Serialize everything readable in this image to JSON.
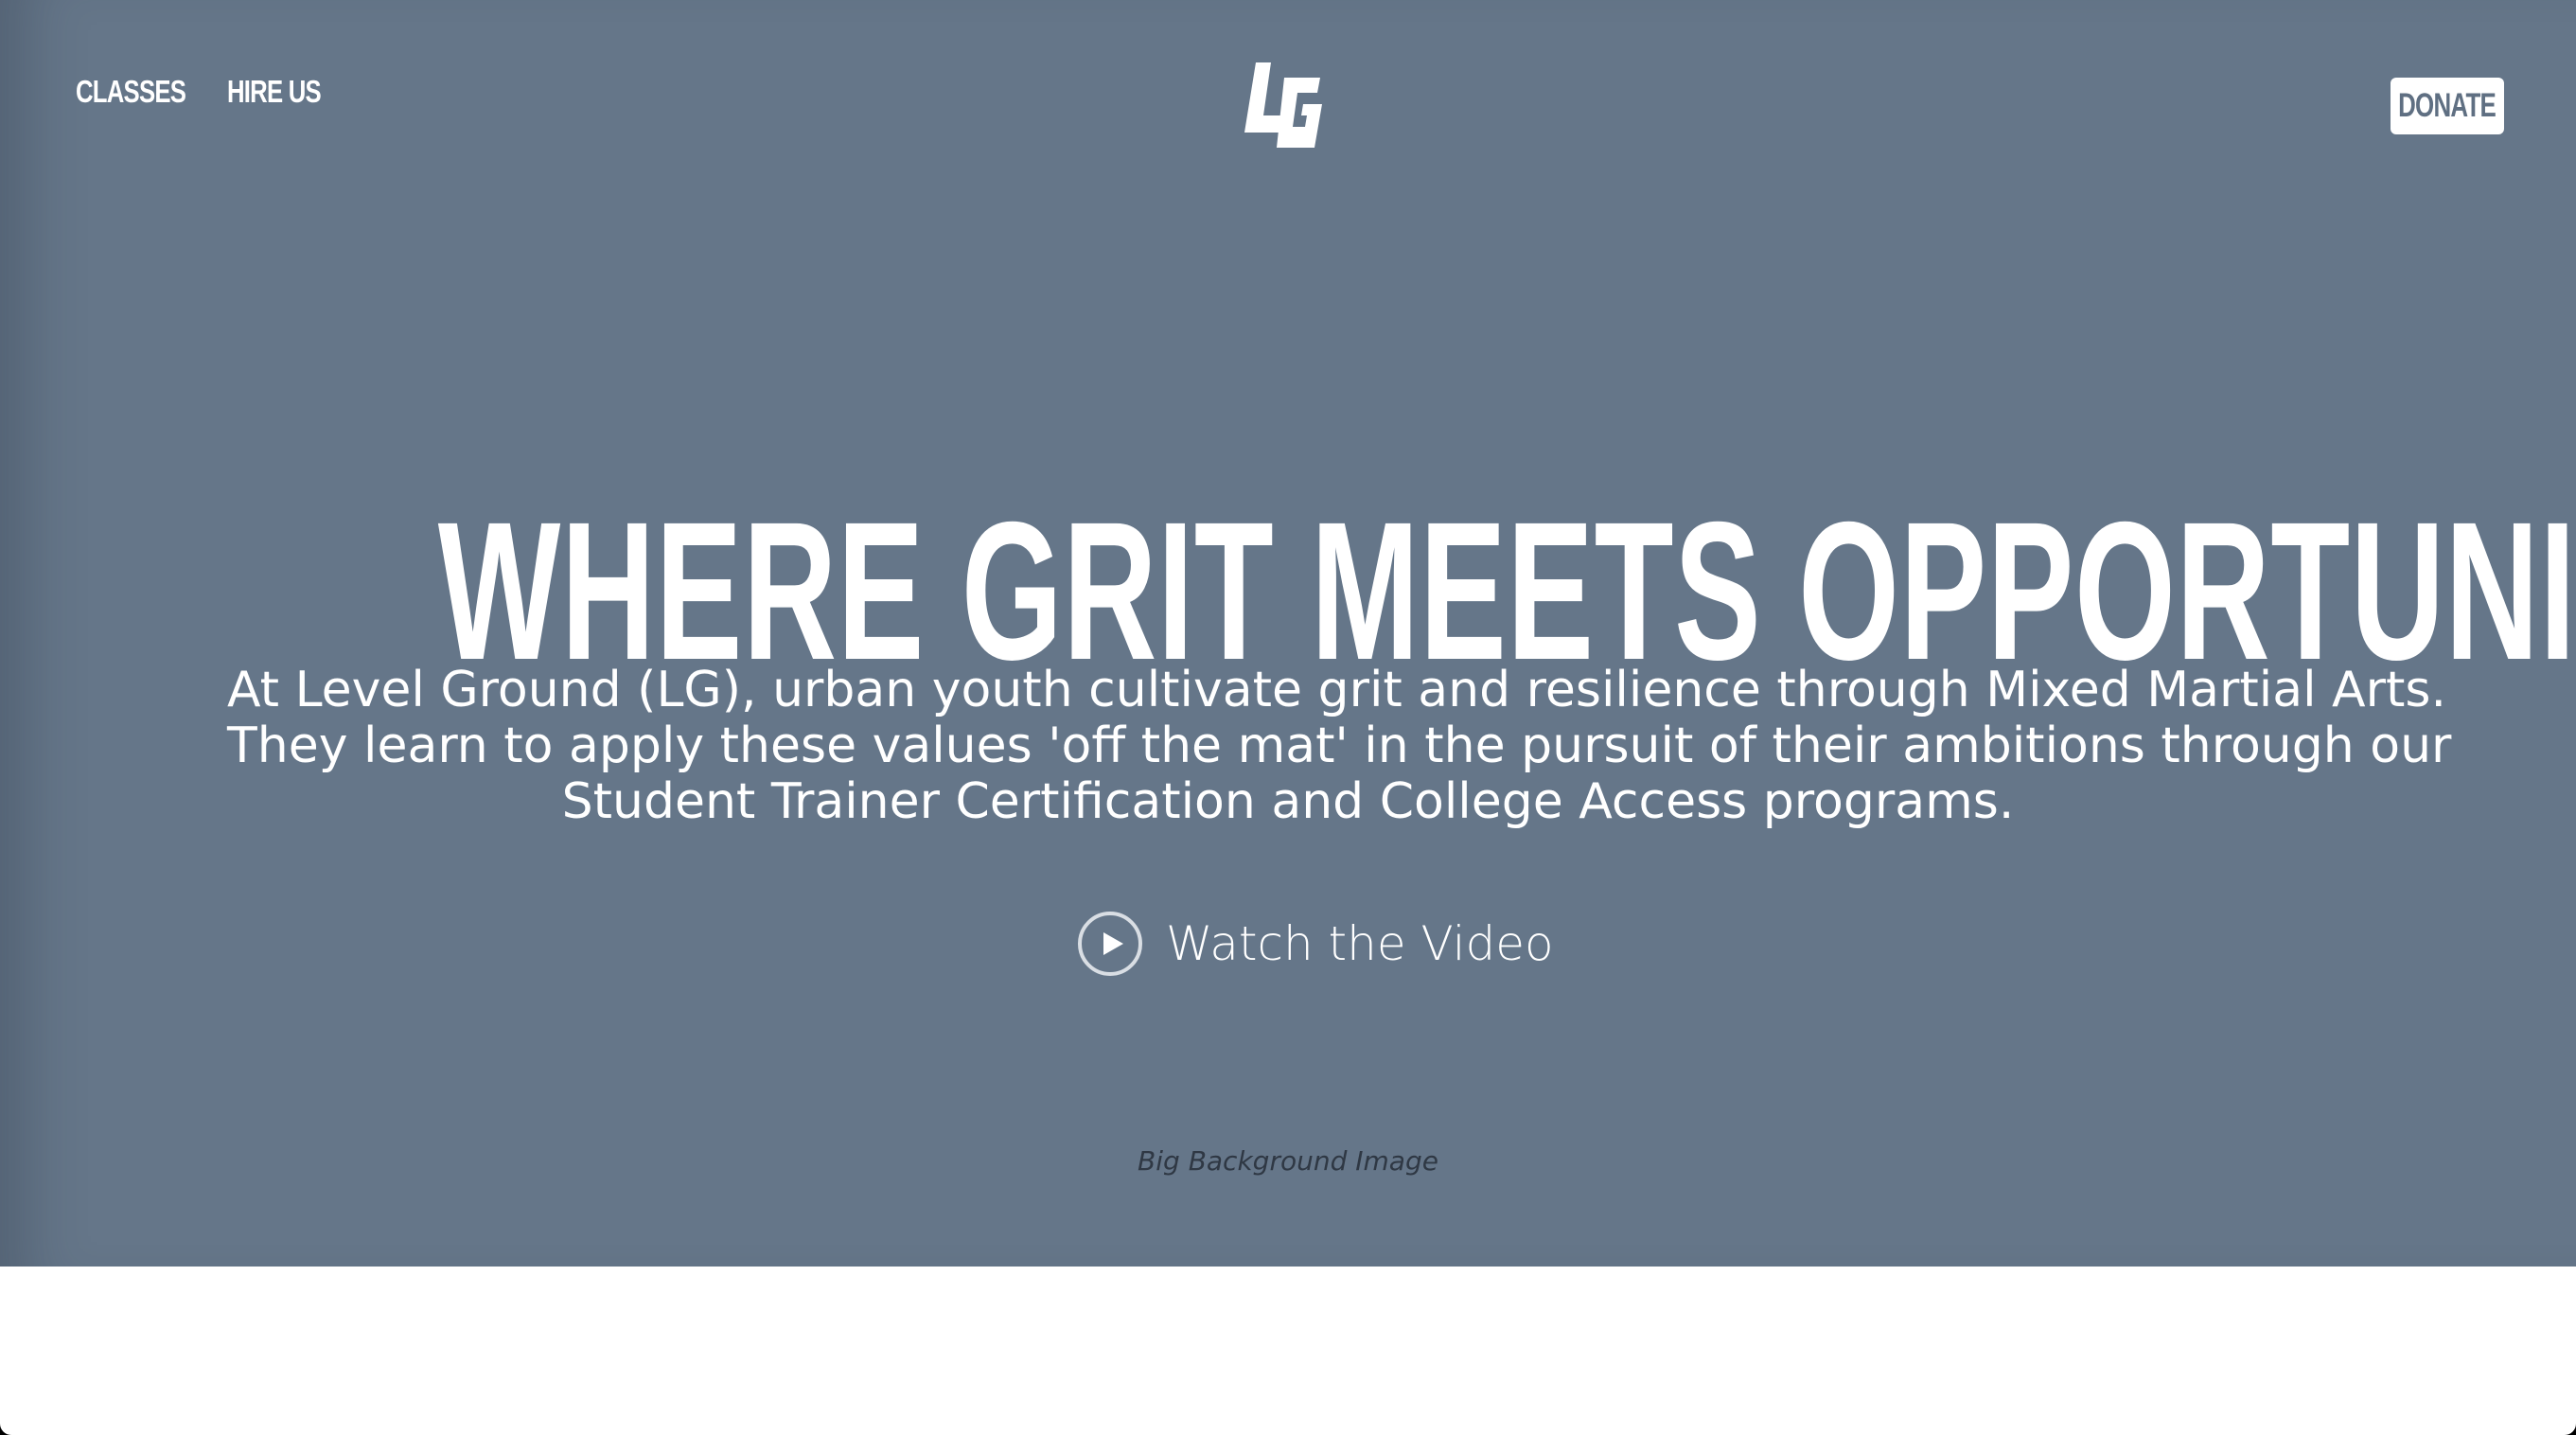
{
  "nav": {
    "items": [
      {
        "label": "CLASSES"
      },
      {
        "label": "HIRE US"
      }
    ],
    "logo_icon": "lg-logo",
    "donate_label": "DONATE"
  },
  "hero": {
    "headline": "WHERE GRIT MEETS OPPORTUNITY",
    "intro_lines": [
      "At Level Ground (LG), urban youth cultivate grit and resilience through Mixed Martial Arts.",
      "They learn to apply these values 'off the mat' in the pursuit of their ambitions through our",
      "Student Trainer Certification and College Access programs."
    ],
    "video_label": "Watch the Video",
    "video_icon": "play-circle-icon",
    "background_caption": "Big Background Image"
  },
  "colors": {
    "hero_background": "#657689",
    "text": "#ffffff",
    "donate_text": "#5f6f82",
    "caption_text": "#2f3844",
    "page_background": "#ffffff"
  }
}
